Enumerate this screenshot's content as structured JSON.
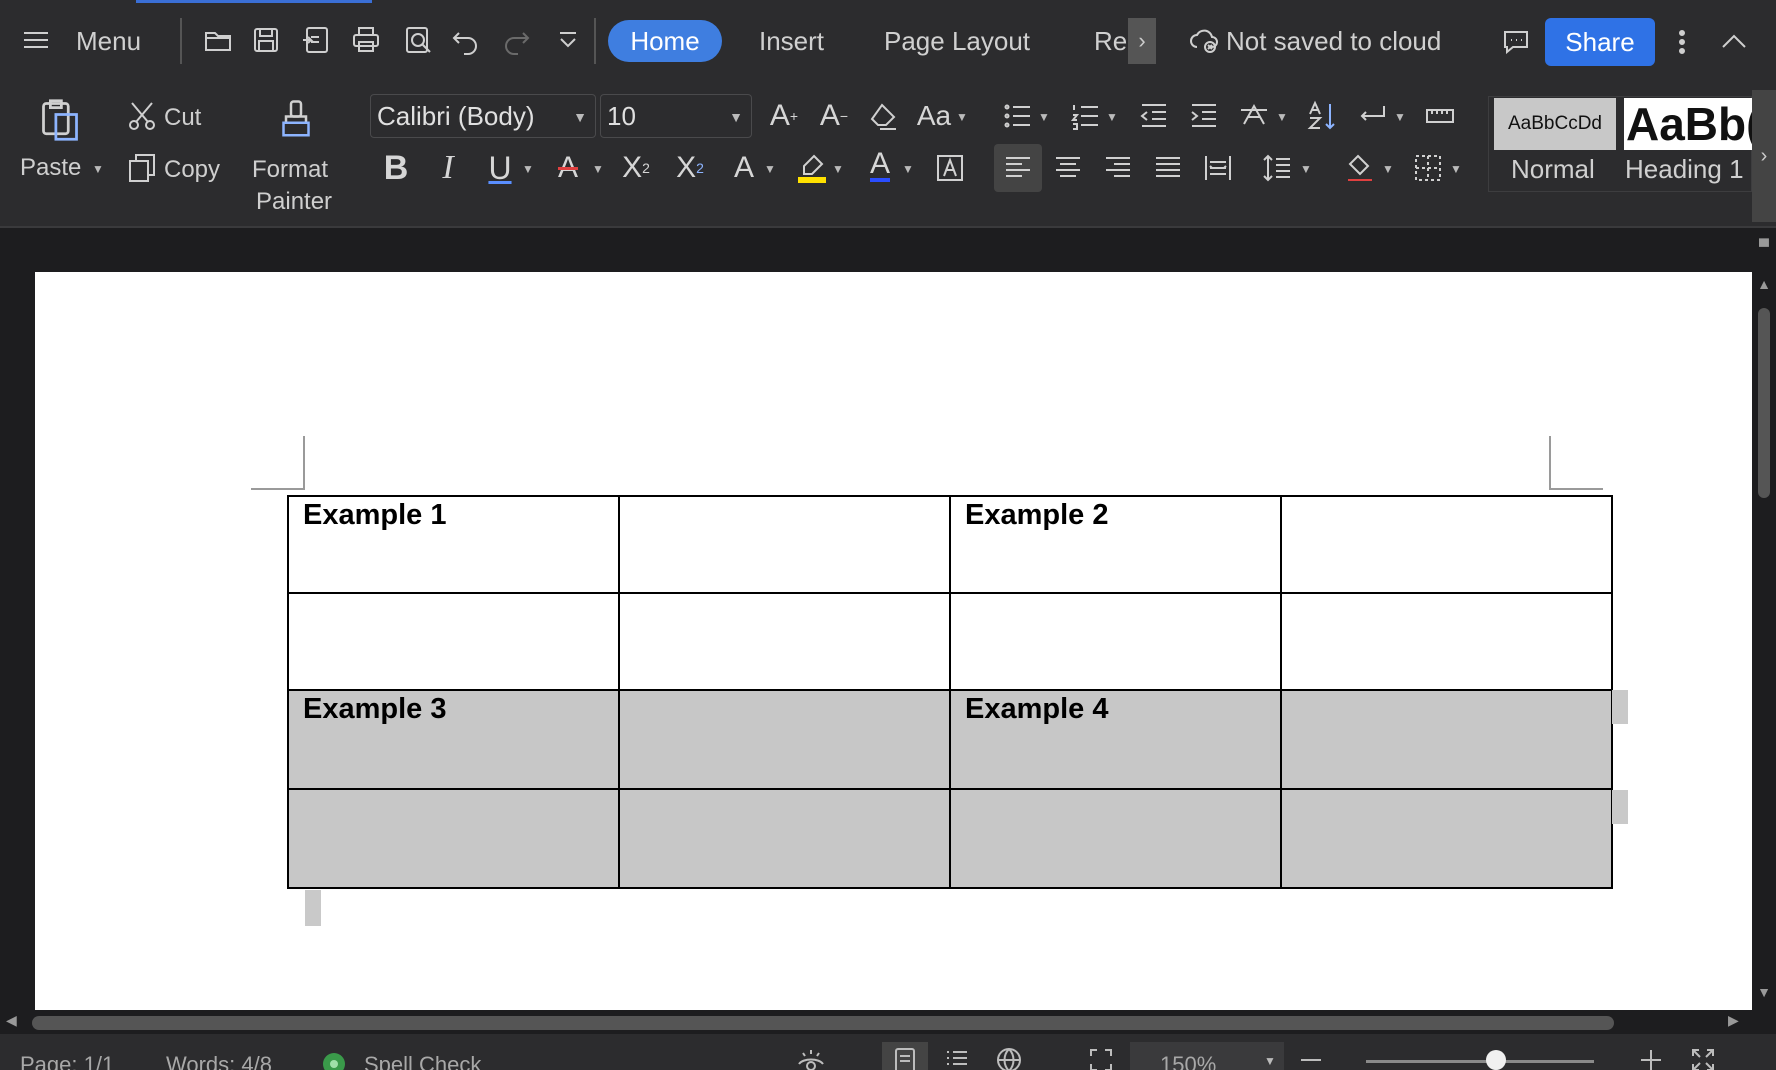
{
  "titlebar": {
    "menu_label": "Menu",
    "tabs": [
      {
        "label": "Home",
        "active": true
      },
      {
        "label": "Insert",
        "active": false
      },
      {
        "label": "Page Layout",
        "active": false
      },
      {
        "label": "Re",
        "active": false
      }
    ],
    "cloud_status": "Not saved to cloud",
    "share_label": "Share",
    "quick_icons": [
      "open-folder-icon",
      "save-icon",
      "export-pdf-icon",
      "print-icon",
      "print-preview-icon",
      "undo-icon",
      "redo-icon",
      "customize-toolbar-icon"
    ]
  },
  "ribbon": {
    "clipboard": {
      "paste_label": "Paste",
      "cut_label": "Cut",
      "copy_label": "Copy",
      "format_painter_line1": "Format",
      "format_painter_line2": "Painter"
    },
    "font": {
      "family": "Calibri (Body)",
      "size": "10"
    },
    "styles": [
      {
        "preview": "AaBbCcDd",
        "name": "Normal"
      },
      {
        "preview": "AaBb(",
        "name": "Heading 1"
      }
    ]
  },
  "document": {
    "table": [
      [
        "Example 1",
        "",
        "Example 2",
        ""
      ],
      [
        "",
        "",
        "",
        ""
      ],
      [
        "Example 3",
        "",
        "Example 4",
        ""
      ],
      [
        "",
        "",
        "",
        ""
      ]
    ],
    "shaded_rows": [
      3,
      4
    ],
    "shade_color": "#c7c7c7"
  },
  "statusbar": {
    "page": "Page: 1/1",
    "words": "Words: 4/8",
    "spell_check": "Spell Check",
    "zoom": "150%",
    "zoom_level_fraction": 0.5
  },
  "colors": {
    "accent": "#3f7ee0",
    "share": "#2f72e6",
    "chrome": "#2c2c2e",
    "workspace": "#1d1d1f"
  }
}
